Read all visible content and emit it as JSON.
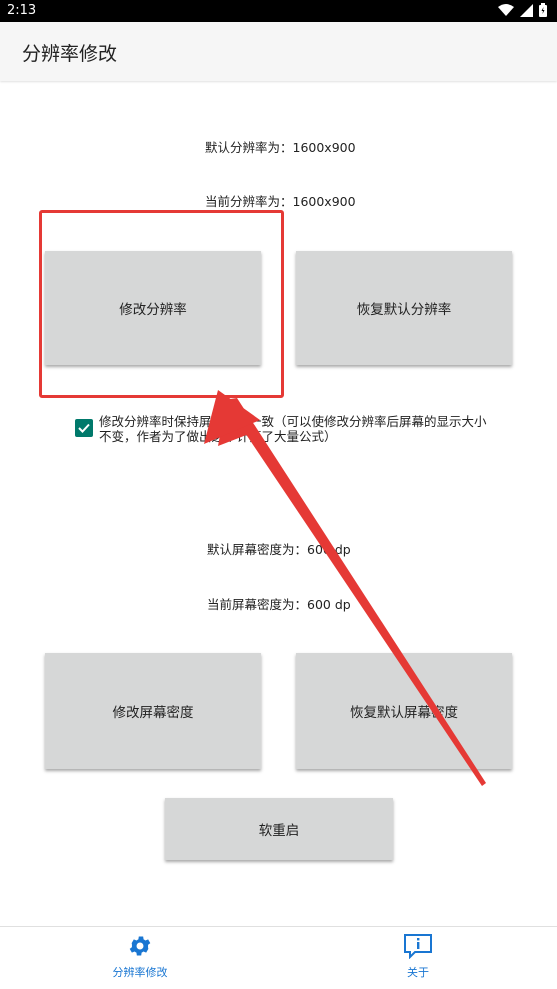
{
  "status_bar": {
    "time": "2:13"
  },
  "app_bar": {
    "title": "分辨率修改"
  },
  "resolution": {
    "default_label": "默认分辨率为：1600x900",
    "current_label": "当前分辨率为：1600x900",
    "modify_button": "修改分辨率",
    "restore_button": "恢复默认分辨率",
    "keep_density_checkbox": {
      "checked": true,
      "label": "修改分辨率时保持屏幕密度一致（可以使修改分辨率后屏幕的显示大小不变，作者为了做出这个计算了大量公式）"
    }
  },
  "density": {
    "default_label": "默认屏幕密度为：600 dp",
    "current_label": "当前屏幕密度为：600 dp",
    "modify_button": "修改屏幕密度",
    "restore_button": "恢复默认屏幕密度"
  },
  "soft_reboot_button": "软重启",
  "bottom_nav": {
    "items": [
      {
        "label": "分辨率修改",
        "icon": "gear-icon",
        "active": true
      },
      {
        "label": "关于",
        "icon": "info-icon",
        "active": false
      }
    ]
  },
  "colors": {
    "accent": "#1976d2",
    "checkbox": "#00796b",
    "highlight": "#e53935",
    "button_bg": "#d6d7d7"
  }
}
